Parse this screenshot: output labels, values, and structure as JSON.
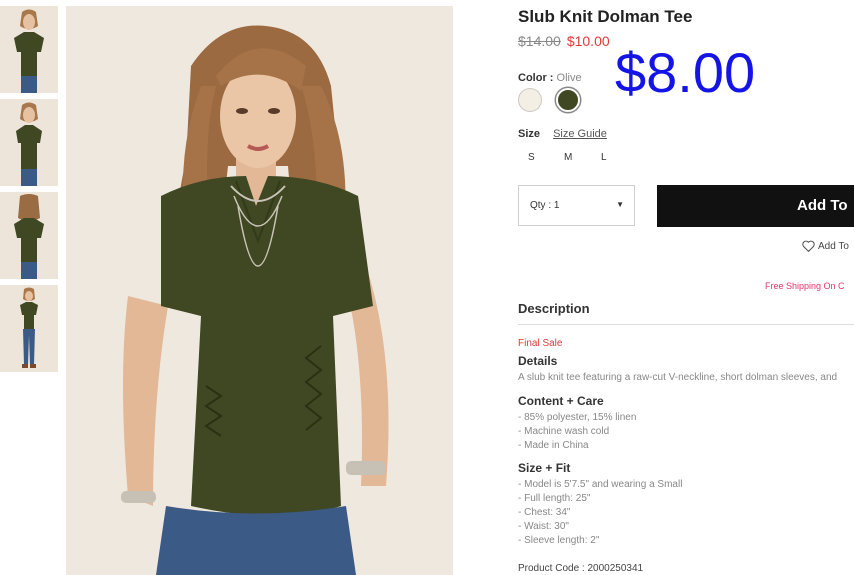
{
  "product": {
    "title": "Slub Knit Dolman Tee",
    "old_price": "$14.00",
    "new_price": "$10.00",
    "overlay_price": "$8.00"
  },
  "color": {
    "label": "Color :",
    "value": "Olive",
    "swatches": [
      {
        "name": "cream",
        "hex": "#f3efe4"
      },
      {
        "name": "olive",
        "hex": "#3f4823",
        "selected": true
      }
    ]
  },
  "size": {
    "label": "Size",
    "guide": "Size Guide",
    "options": [
      "S",
      "M",
      "L"
    ]
  },
  "qty": {
    "label": "Qty : 1"
  },
  "add_button": "Add To",
  "wishlist": "Add To",
  "shipping": "Free Shipping On C",
  "description": {
    "heading": "Description",
    "final_sale": "Final Sale",
    "details_heading": "Details",
    "details_text": "A slub knit tee featuring a raw-cut V-neckline, short dolman sleeves, and",
    "content_heading": "Content + Care",
    "content_lines": [
      "- 85% polyester, 15% linen",
      "- Machine wash cold",
      "- Made in China"
    ],
    "fit_heading": "Size + Fit",
    "fit_lines": [
      "- Model is 5'7.5\" and wearing a Small",
      "- Full length: 25\"",
      "- Chest: 34\"",
      "- Waist: 30\"",
      "- Sleeve length: 2\""
    ],
    "product_code": "Product Code : 2000250341"
  },
  "colors": {
    "accent_red": "#e03a3a",
    "overlay_blue": "#1414e6",
    "shipping_pink": "#e2366a",
    "button": "#111111"
  }
}
